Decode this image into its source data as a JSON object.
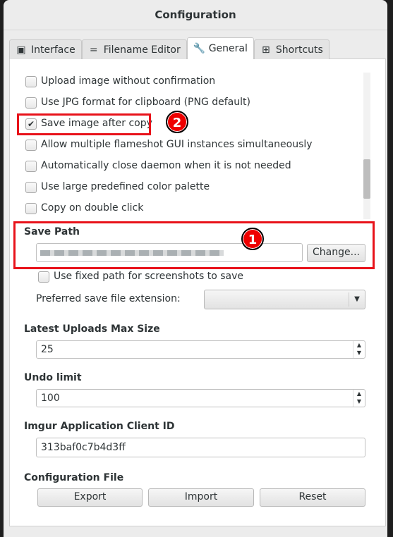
{
  "window": {
    "title": "Configuration"
  },
  "tabs": [
    {
      "label": "Interface",
      "icon": "interface-icon"
    },
    {
      "label": "Filename Editor",
      "icon": "filename-icon"
    },
    {
      "label": "General",
      "icon": "wrench-icon",
      "active": true
    },
    {
      "label": "Shortcuts",
      "icon": "grid-icon"
    }
  ],
  "options": [
    {
      "label": "Upload image without confirmation",
      "checked": false
    },
    {
      "label": "Use JPG format for clipboard (PNG default)",
      "checked": false
    },
    {
      "label": "Save image after copy",
      "checked": true
    },
    {
      "label": "Allow multiple flameshot GUI instances simultaneously",
      "checked": false
    },
    {
      "label": "Automatically close daemon when it is not needed",
      "checked": false
    },
    {
      "label": "Use large predefined color palette",
      "checked": false
    },
    {
      "label": "Copy on double click",
      "checked": false
    }
  ],
  "save_path": {
    "title": "Save Path",
    "change_label": "Change...",
    "fixed_path_label": "Use fixed path for screenshots to save",
    "fixed_path_checked": false,
    "extension_label": "Preferred save file extension:",
    "extension_value": ""
  },
  "uploads": {
    "title": "Latest Uploads Max Size",
    "value": "25"
  },
  "undo": {
    "title": "Undo limit",
    "value": "100"
  },
  "imgur": {
    "title": "Imgur Application Client ID",
    "value": "313baf0c7b4d3ff"
  },
  "config_file": {
    "title": "Configuration File",
    "export": "Export",
    "import": "Import",
    "reset": "Reset"
  },
  "annotations": {
    "badge1": "1",
    "badge2": "2",
    "color": "#e8121a"
  }
}
